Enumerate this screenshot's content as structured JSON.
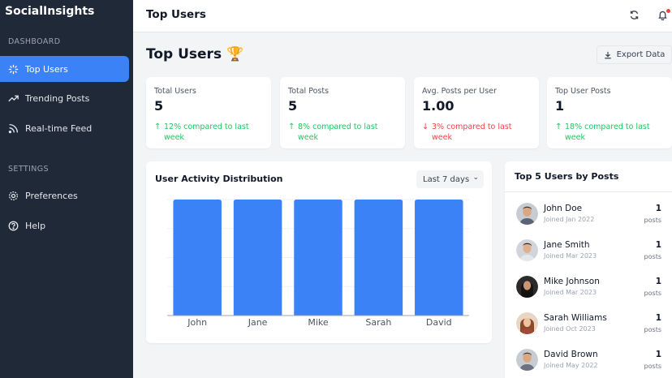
{
  "app": {
    "brand": "SocialInsights"
  },
  "sidebar": {
    "sections": [
      {
        "label": "DASHBOARD",
        "items": [
          {
            "label": "Top Users",
            "icon": "sparkle-icon",
            "active": true
          },
          {
            "label": "Trending Posts",
            "icon": "trending-up-icon",
            "active": false
          },
          {
            "label": "Real-time Feed",
            "icon": "rss-icon",
            "active": false
          }
        ]
      },
      {
        "label": "SETTINGS",
        "items": [
          {
            "label": "Preferences",
            "icon": "gear-icon",
            "active": false
          },
          {
            "label": "Help",
            "icon": "help-circle-icon",
            "active": false
          }
        ]
      }
    ]
  },
  "header": {
    "title": "Top Users",
    "icons": [
      "refresh-icon",
      "bell-icon"
    ]
  },
  "page": {
    "title": "Top Users 🏆",
    "export_label": "Export Data"
  },
  "stats": [
    {
      "label": "Total Users",
      "value": "5",
      "change": "12% compared to last week",
      "direction": "up"
    },
    {
      "label": "Total Posts",
      "value": "5",
      "change": "8% compared to last week",
      "direction": "up"
    },
    {
      "label": "Avg. Posts per User",
      "value": "1.00",
      "change": "3% compared to last week",
      "direction": "down"
    },
    {
      "label": "Top User Posts",
      "value": "1",
      "change": "18% compared to last week",
      "direction": "up"
    }
  ],
  "chart_panel": {
    "title": "User Activity Distribution",
    "range": "Last 7 days"
  },
  "chart_data": {
    "type": "bar",
    "categories": [
      "John",
      "Jane",
      "Mike",
      "Sarah",
      "David"
    ],
    "values": [
      1,
      1,
      1,
      1,
      1
    ],
    "title": "User Activity Distribution",
    "xlabel": "",
    "ylabel": "",
    "ylim": [
      0,
      1
    ],
    "grid": true,
    "color": "#3b82f6"
  },
  "top_users": {
    "title": "Top 5 Users by Posts",
    "unit": "posts",
    "users": [
      {
        "name": "John Doe",
        "joined": "Joined Jan 2022",
        "posts": "1"
      },
      {
        "name": "Jane Smith",
        "joined": "Joined Mar 2023",
        "posts": "1"
      },
      {
        "name": "Mike Johnson",
        "joined": "Joined Mar 2023",
        "posts": "1"
      },
      {
        "name": "Sarah Williams",
        "joined": "Joined Oct 2023",
        "posts": "1"
      },
      {
        "name": "David Brown",
        "joined": "Joined May 2022",
        "posts": "1"
      }
    ]
  },
  "colors": {
    "accent": "#3b82f6",
    "sidebar": "#1f2937",
    "up": "#22c55e",
    "down": "#ef4444"
  }
}
